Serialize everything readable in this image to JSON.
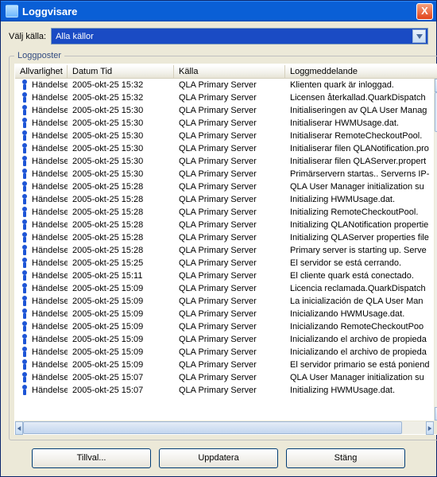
{
  "window": {
    "title": "Loggvisare",
    "close": "X"
  },
  "source": {
    "label": "Välj källa:",
    "selected": "Alla källor"
  },
  "fieldset": {
    "legend": "Loggposter"
  },
  "columns": {
    "severity": "Allvarlighet",
    "datetime": "Datum Tid",
    "source": "Källa",
    "message": "Loggmeddelande"
  },
  "rows": [
    {
      "sev": "Händelse",
      "dt": "2005-okt-25 15:32",
      "src": "QLA Primary Server",
      "msg": "Klienten quark är inloggad."
    },
    {
      "sev": "Händelse",
      "dt": "2005-okt-25 15:32",
      "src": "QLA Primary Server",
      "msg": "Licensen återkallad.QuarkDispatch"
    },
    {
      "sev": "Händelse",
      "dt": "2005-okt-25 15:30",
      "src": "QLA Primary Server",
      "msg": "Initialiseringen av QLA User Manag"
    },
    {
      "sev": "Händelse",
      "dt": "2005-okt-25 15:30",
      "src": "QLA Primary Server",
      "msg": "Initialiserar HWMUsage.dat."
    },
    {
      "sev": "Händelse",
      "dt": "2005-okt-25 15:30",
      "src": "QLA Primary Server",
      "msg": "Initialiserar RemoteCheckoutPool."
    },
    {
      "sev": "Händelse",
      "dt": "2005-okt-25 15:30",
      "src": "QLA Primary Server",
      "msg": "Initialiserar filen QLANotification.pro"
    },
    {
      "sev": "Händelse",
      "dt": "2005-okt-25 15:30",
      "src": "QLA Primary Server",
      "msg": "Initialiserar filen QLAServer.propert"
    },
    {
      "sev": "Händelse",
      "dt": "2005-okt-25 15:30",
      "src": "QLA Primary Server",
      "msg": "Primärservern startas.. Serverns IP-"
    },
    {
      "sev": "Händelse",
      "dt": "2005-okt-25 15:28",
      "src": "QLA Primary Server",
      "msg": "QLA User Manager initialization su"
    },
    {
      "sev": "Händelse",
      "dt": "2005-okt-25 15:28",
      "src": "QLA Primary Server",
      "msg": "Initializing HWMUsage.dat."
    },
    {
      "sev": "Händelse",
      "dt": "2005-okt-25 15:28",
      "src": "QLA Primary Server",
      "msg": "Initializing RemoteCheckoutPool."
    },
    {
      "sev": "Händelse",
      "dt": "2005-okt-25 15:28",
      "src": "QLA Primary Server",
      "msg": "Initializing QLANotification propertie"
    },
    {
      "sev": "Händelse",
      "dt": "2005-okt-25 15:28",
      "src": "QLA Primary Server",
      "msg": "Initializing QLAServer properties file"
    },
    {
      "sev": "Händelse",
      "dt": "2005-okt-25 15:28",
      "src": "QLA Primary Server",
      "msg": "Primary server is starting up. Serve"
    },
    {
      "sev": "Händelse",
      "dt": "2005-okt-25 15:25",
      "src": "QLA Primary Server",
      "msg": "El servidor se está cerrando."
    },
    {
      "sev": "Händelse",
      "dt": "2005-okt-25 15:11",
      "src": "QLA Primary Server",
      "msg": "El cliente quark está conectado."
    },
    {
      "sev": "Händelse",
      "dt": "2005-okt-25 15:09",
      "src": "QLA Primary Server",
      "msg": "Licencia reclamada.QuarkDispatch"
    },
    {
      "sev": "Händelse",
      "dt": "2005-okt-25 15:09",
      "src": "QLA Primary Server",
      "msg": "La inicialización de QLA User Man"
    },
    {
      "sev": "Händelse",
      "dt": "2005-okt-25 15:09",
      "src": "QLA Primary Server",
      "msg": "Inicializando HWMUsage.dat."
    },
    {
      "sev": "Händelse",
      "dt": "2005-okt-25 15:09",
      "src": "QLA Primary Server",
      "msg": "Inicializando RemoteCheckoutPoo"
    },
    {
      "sev": "Händelse",
      "dt": "2005-okt-25 15:09",
      "src": "QLA Primary Server",
      "msg": "Inicializando el archivo de propieda"
    },
    {
      "sev": "Händelse",
      "dt": "2005-okt-25 15:09",
      "src": "QLA Primary Server",
      "msg": "Inicializando el archivo de propieda"
    },
    {
      "sev": "Händelse",
      "dt": "2005-okt-25 15:09",
      "src": "QLA Primary Server",
      "msg": "El servidor primario se está poniend"
    },
    {
      "sev": "Händelse",
      "dt": "2005-okt-25 15:07",
      "src": "QLA Primary Server",
      "msg": "QLA User Manager initialization su"
    },
    {
      "sev": "Händelse",
      "dt": "2005-okt-25 15:07",
      "src": "QLA Primary Server",
      "msg": "Initializing HWMUsage.dat."
    }
  ],
  "buttons": {
    "options": "Tillval...",
    "refresh": "Uppdatera",
    "close": "Stäng"
  }
}
